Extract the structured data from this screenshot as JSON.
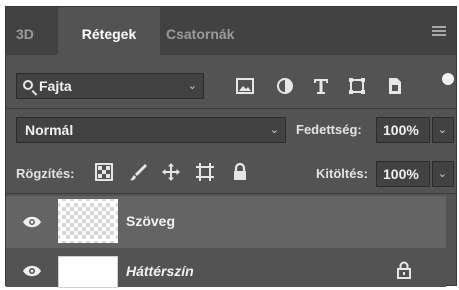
{
  "tabs": [
    {
      "label": "3D",
      "active": false
    },
    {
      "label": "Rétegek",
      "active": true
    },
    {
      "label": "Csatornák",
      "active": false
    }
  ],
  "filter": {
    "kind_label": "Fajta",
    "icons": [
      "image-filter-icon",
      "adjustment-filter-icon",
      "type-filter-icon",
      "shape-filter-icon",
      "smart-object-filter-icon"
    ]
  },
  "blend_mode": {
    "value": "Normál"
  },
  "opacity": {
    "label": "Fedettség:",
    "value": "100%"
  },
  "lock": {
    "label": "Rögzítés:",
    "icons": [
      "lock-transparent-pixels-icon",
      "lock-image-pixels-icon",
      "lock-position-icon",
      "lock-artboard-icon",
      "lock-all-icon"
    ]
  },
  "fill": {
    "label": "Kitöltés:",
    "value": "100%"
  },
  "layers": [
    {
      "name": "Szöveg",
      "visible": true,
      "selected": true,
      "locked": false
    },
    {
      "name": "Háttérszín",
      "visible": true,
      "selected": false,
      "locked": true
    }
  ],
  "colors": {
    "panel": "#535353",
    "tab_bar": "#424242",
    "selected_layer": "#646464",
    "text": "#f2f2f2"
  }
}
